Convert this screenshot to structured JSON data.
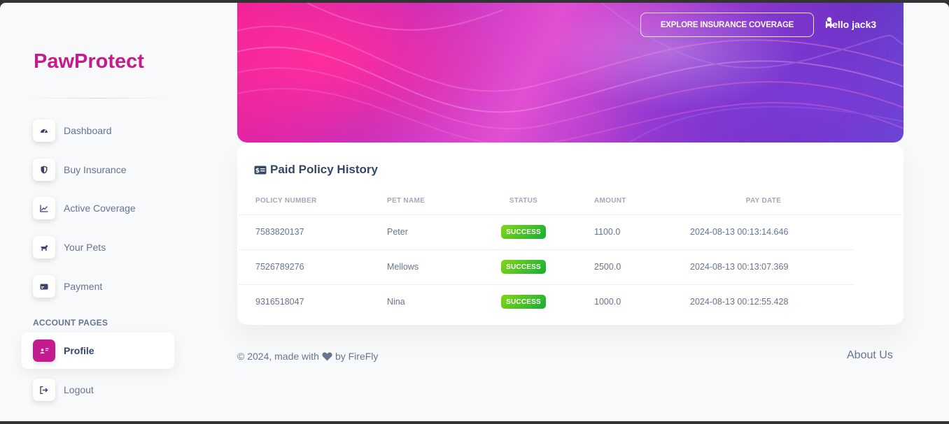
{
  "brand": "PawProtect",
  "sidebar": {
    "items": [
      {
        "label": "Dashboard",
        "icon": "dashboard-icon"
      },
      {
        "label": "Buy Insurance",
        "icon": "shield-icon"
      },
      {
        "label": "Active Coverage",
        "icon": "chart-icon"
      },
      {
        "label": "Your Pets",
        "icon": "dog-icon"
      },
      {
        "label": "Payment",
        "icon": "card-icon"
      }
    ],
    "section_title": "ACCOUNT PAGES",
    "account_items": [
      {
        "label": "Profile",
        "icon": "user-card-icon",
        "active": true
      },
      {
        "label": "Logout",
        "icon": "logout-icon"
      }
    ]
  },
  "header": {
    "explore_button": "EXPLORE INSURANCE COVERAGE",
    "greeting": "Hello jack3"
  },
  "card": {
    "title": "Paid Policy History",
    "columns": [
      "POLICY NUMBER",
      "PET NAME",
      "STATUS",
      "AMOUNT",
      "PAY DATE"
    ],
    "rows": [
      {
        "policy": "7583820137",
        "pet": "Peter",
        "status": "SUCCESS",
        "amount": "1100.0",
        "date": "2024-08-13 00:13:14.646"
      },
      {
        "policy": "7526789276",
        "pet": "Mellows",
        "status": "SUCCESS",
        "amount": "2500.0",
        "date": "2024-08-13 00:13:07.369"
      },
      {
        "policy": "9316518047",
        "pet": "Nina",
        "status": "SUCCESS",
        "amount": "1000.0",
        "date": "2024-08-13 00:12:55.428"
      }
    ]
  },
  "footer": {
    "copyright_prefix": "© 2024, made with",
    "copyright_suffix": "by FireFly",
    "about": "About Us"
  },
  "colors": {
    "brand": "#c41b8f",
    "success_start": "#82d616",
    "success_end": "#17ad37",
    "text_muted": "#67748e"
  }
}
